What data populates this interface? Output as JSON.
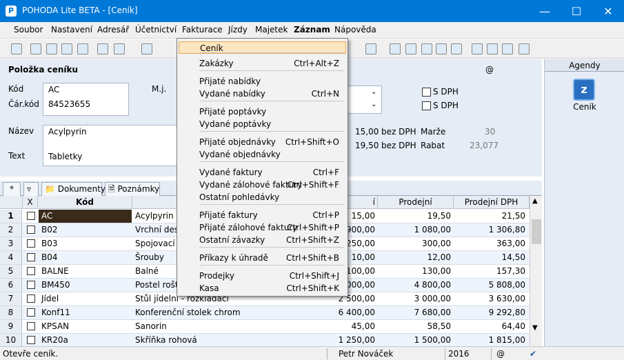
{
  "window": {
    "title": "POHODA Lite BETA - [Ceník]",
    "app_icon": "pohoda-logo-icon"
  },
  "menubar": {
    "items": [
      "Soubor",
      "Nastavení",
      "Adresář",
      "Účetnictví",
      "Fakturace",
      "Jízdy",
      "Majetek",
      "Záznam",
      "Nápověda"
    ]
  },
  "form": {
    "section_title": "Položka ceníku",
    "at_symbol": "@",
    "kod_label": "Kód",
    "kod_value": "AC",
    "carkod_label": "Čár.kód",
    "carkod_value": "84523655",
    "mj_label": "M.j.",
    "sdph1": "S DPH",
    "sdph2": "S DPH",
    "nazev_label": "Název",
    "nazev_value": "Acylpyrin",
    "text_label": "Text",
    "text_value": "Tabletky",
    "price1": "15,00",
    "price1_unit": "bez DPH",
    "marze_label": "Marže",
    "marze_value": "30",
    "price2": "19,50",
    "price2_unit": "bez DPH",
    "rabat_label": "Rabat",
    "rabat_value": "23,077"
  },
  "agendy": {
    "header": "Agendy",
    "item": "Ceník"
  },
  "tabs": {
    "star": "*",
    "dokumenty": "Dokumenty",
    "poznamky": "Poznámky"
  },
  "grid": {
    "headers": {
      "x": "X",
      "kod": "Kód",
      "nakup": "í",
      "prodejni": "Prodejní",
      "prodejni_dph": "Prodejní DPH"
    },
    "rows": [
      {
        "n": "1",
        "kod": "AC",
        "nazev": "Acylpyrin",
        "nakup": "15,00",
        "prodej": "19,50",
        "dph": "21,50"
      },
      {
        "n": "2",
        "kod": "B02",
        "nazev": "Vrchní desk",
        "nakup": "900,00",
        "prodej": "1 080,00",
        "dph": "1 306,80"
      },
      {
        "n": "3",
        "kod": "B03",
        "nazev": "Spojovací c",
        "nakup": "250,00",
        "prodej": "300,00",
        "dph": "363,00"
      },
      {
        "n": "4",
        "kod": "B04",
        "nazev": "Šrouby",
        "nakup": "10,00",
        "prodej": "12,00",
        "dph": "14,50"
      },
      {
        "n": "5",
        "kod": "BALNE",
        "nazev": "Balné",
        "nakup": "100,00",
        "prodej": "130,00",
        "dph": "157,30"
      },
      {
        "n": "6",
        "kod": "BM450",
        "nazev": "Postel rošto",
        "nakup": "000,00",
        "prodej": "4 800,00",
        "dph": "5 808,00"
      },
      {
        "n": "7",
        "kod": "Jídel",
        "nazev": "Stůl jídelní - rozkládací",
        "nakup": "2 500,00",
        "prodej": "3 000,00",
        "dph": "3 630,00"
      },
      {
        "n": "8",
        "kod": "Konf11",
        "nazev": "Konferenční stolek chrom",
        "nakup": "6 400,00",
        "prodej": "7 680,00",
        "dph": "9 292,80"
      },
      {
        "n": "9",
        "kod": "KPSAN",
        "nazev": "Sanorin",
        "nakup": "45,00",
        "prodej": "58,50",
        "dph": "64,40"
      },
      {
        "n": "10",
        "kod": "KR20a",
        "nazev": "Skříňka rohová",
        "nakup": "1 250,00",
        "prodej": "1 500,00",
        "dph": "1 815,00"
      }
    ]
  },
  "status": {
    "left": "Otevře ceník.",
    "user": "Petr Nováček",
    "year": "2016",
    "at": "@"
  },
  "dropdown": {
    "groups": [
      [
        {
          "label": "Ceník",
          "shortcut": ""
        }
      ],
      [
        {
          "label": "Zakázky",
          "shortcut": "Ctrl+Alt+Z"
        }
      ],
      [
        {
          "label": "Přijaté nabídky",
          "shortcut": ""
        },
        {
          "label": "Vydané nabídky",
          "shortcut": "Ctrl+N"
        }
      ],
      [
        {
          "label": "Přijaté poptávky",
          "shortcut": ""
        },
        {
          "label": "Vydané poptávky",
          "shortcut": ""
        }
      ],
      [
        {
          "label": "Přijaté objednávky",
          "shortcut": "Ctrl+Shift+O"
        },
        {
          "label": "Vydané objednávky",
          "shortcut": ""
        }
      ],
      [
        {
          "label": "Vydané faktury",
          "shortcut": "Ctrl+F"
        },
        {
          "label": "Vydané zálohové faktury",
          "shortcut": "Ctrl+Shift+F"
        },
        {
          "label": "Ostatní pohledávky",
          "shortcut": ""
        }
      ],
      [
        {
          "label": "Přijaté faktury",
          "shortcut": "Ctrl+P"
        },
        {
          "label": "Přijaté zálohové faktury",
          "shortcut": "Ctrl+Shift+P"
        },
        {
          "label": "Ostatní závazky",
          "shortcut": "Ctrl+Shift+Z"
        }
      ],
      [
        {
          "label": "Příkazy k úhradě",
          "shortcut": "Ctrl+Shift+B"
        }
      ],
      [
        {
          "label": "Prodejky",
          "shortcut": "Ctrl+Shift+J"
        },
        {
          "label": "Kasa",
          "shortcut": "Ctrl+Shift+K"
        }
      ]
    ]
  },
  "colors": {
    "titlebar": "#0078d7",
    "form_bg": "#e5ecf5",
    "highlight": "#fbe6bf",
    "selected_cell": "#3a2a1a"
  }
}
